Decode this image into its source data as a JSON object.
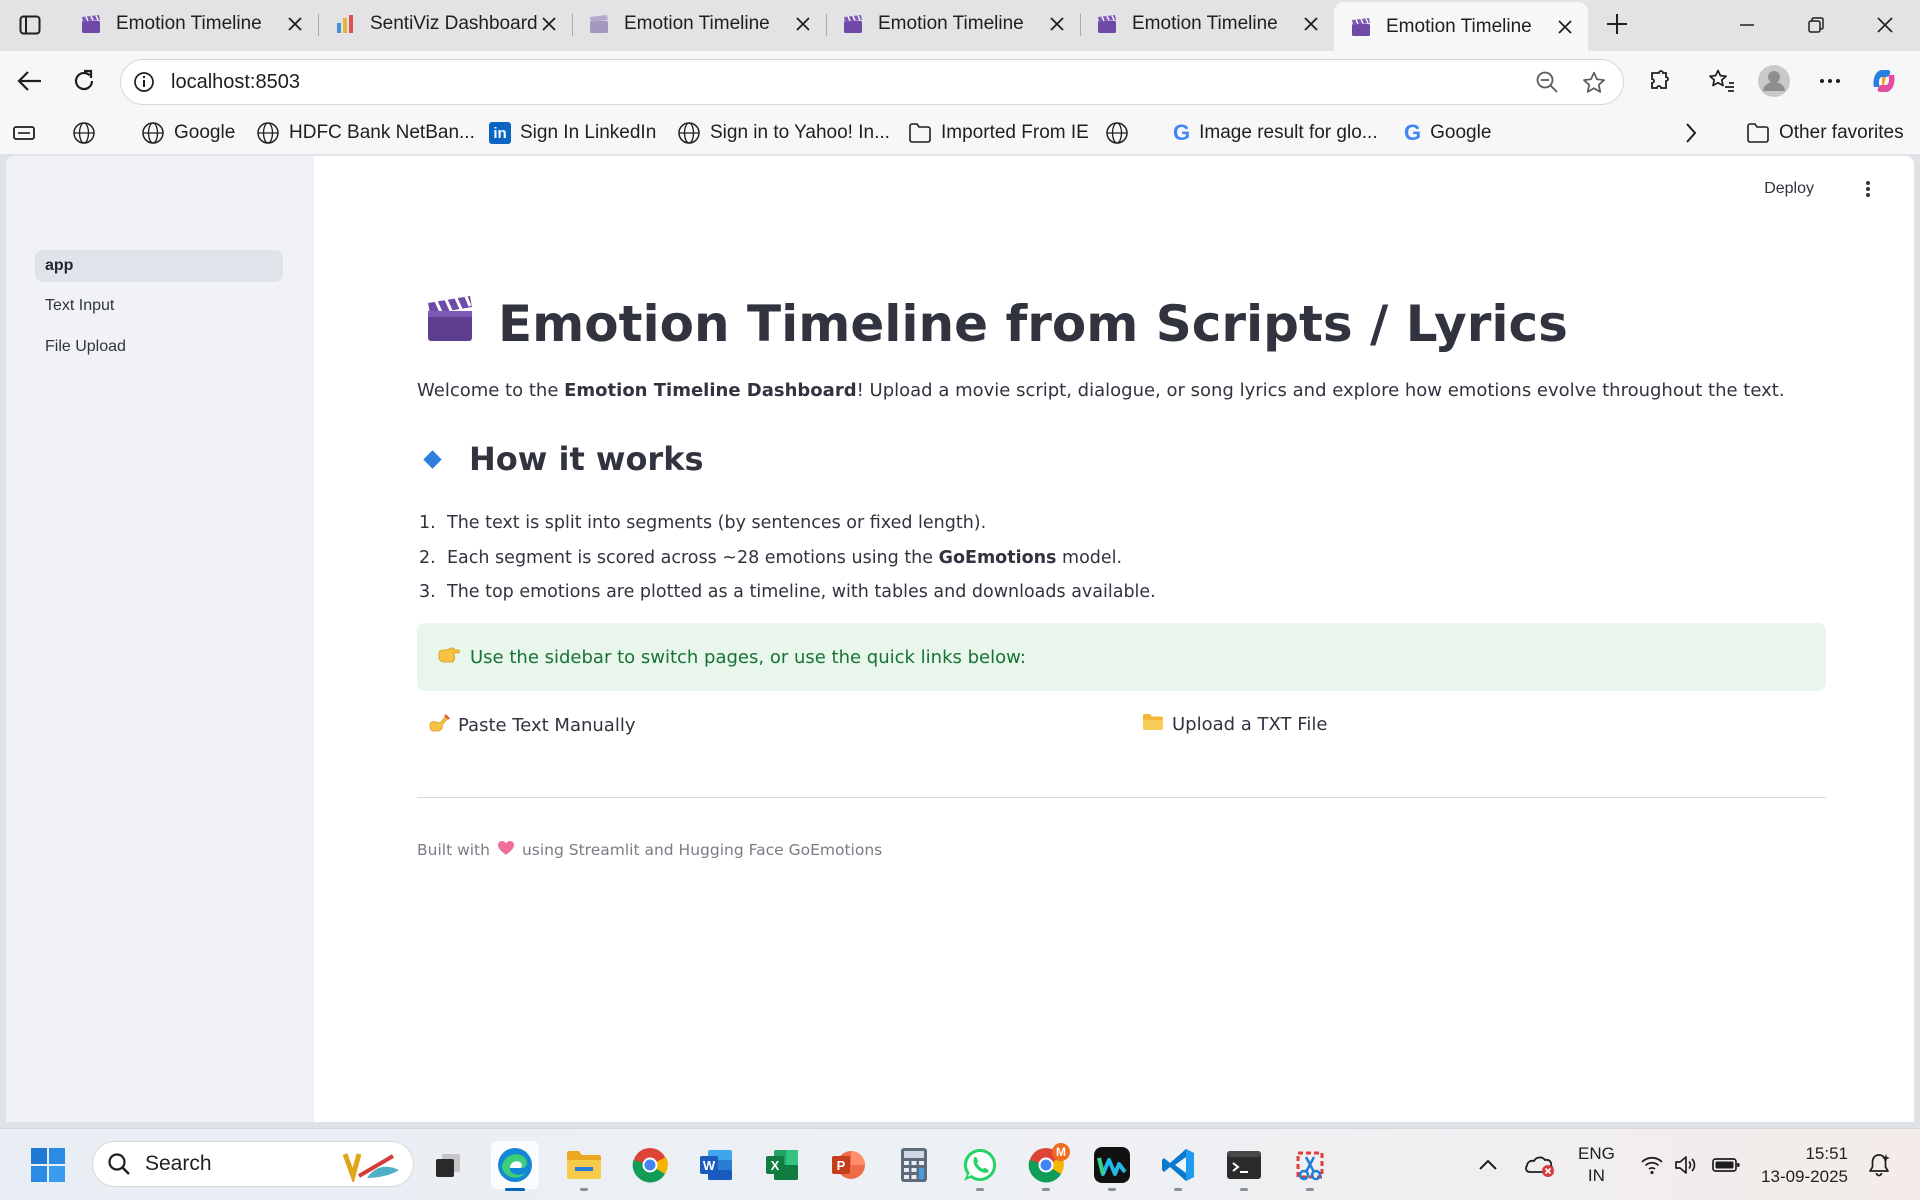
{
  "browser": {
    "tabs": [
      {
        "title": "Emotion Timeline",
        "favicon": "clapper-icon",
        "active": false
      },
      {
        "title": "SentiViz Dashboard",
        "favicon": "bar-chart-icon",
        "active": false
      },
      {
        "title": "Emotion Timeline",
        "favicon": "clapper-icon",
        "active": false
      },
      {
        "title": "Emotion Timeline",
        "favicon": "clapper-icon",
        "active": false
      },
      {
        "title": "Emotion Timeline",
        "favicon": "clapper-icon",
        "active": false
      },
      {
        "title": "Emotion Timeline",
        "favicon": "clapper-icon",
        "active": true
      }
    ],
    "url": "localhost:8503",
    "favorites": [
      {
        "label": "Google",
        "icon": "globe-icon"
      },
      {
        "label": "HDFC Bank NetBan...",
        "icon": "globe-icon"
      },
      {
        "label": "Sign In  LinkedIn",
        "icon": "linkedin-icon"
      },
      {
        "label": "Sign in to Yahoo! In...",
        "icon": "globe-icon"
      },
      {
        "label": "Imported From IE",
        "icon": "folder-icon"
      },
      {
        "label": "Image result for glo...",
        "icon": "google-icon"
      },
      {
        "label": "Google",
        "icon": "google-icon"
      }
    ],
    "other_favorites": "Other favorites"
  },
  "sidebar": {
    "items": [
      {
        "label": "app",
        "active": true
      },
      {
        "label": "Text Input",
        "active": false
      },
      {
        "label": "File Upload",
        "active": false
      }
    ]
  },
  "header": {
    "deploy_label": "Deploy"
  },
  "main": {
    "title": "Emotion Timeline from Scripts / Lyrics",
    "intro": {
      "prefix": "Welcome to the ",
      "bold": "Emotion Timeline Dashboard",
      "suffix": "! Upload a movie script, dialogue, or song lyrics and explore how emotions evolve throughout the text."
    },
    "how_heading": "How it works",
    "steps": [
      {
        "num": "1.",
        "pre": "The text is split into segments (by sentences or fixed length).",
        "bold": "",
        "post": ""
      },
      {
        "num": "2.",
        "pre": "Each segment is scored across ~28 emotions using the ",
        "bold": "GoEmotions",
        "post": " model."
      },
      {
        "num": "3.",
        "pre": "The top emotions are plotted as a timeline, with tables and downloads available.",
        "bold": "",
        "post": ""
      }
    ],
    "callout": "Use the sidebar to switch pages, or use the quick links below:",
    "quick_links": {
      "paste": "Paste Text Manually",
      "upload": "Upload a TXT File"
    },
    "footer": {
      "prefix": "Built with",
      "suffix": "using Streamlit and Hugging Face GoEmotions"
    }
  },
  "taskbar": {
    "search_label": "Search",
    "lang_top": "ENG",
    "lang_bottom": "IN",
    "time": "15:51",
    "date": "13-09-2025",
    "chrome_badge": "M"
  },
  "colors": {
    "accent": "#2f7fde",
    "callout_bg": "#e8f6ec",
    "callout_text": "#177233",
    "sidebar_bg": "#f0f2f6"
  }
}
